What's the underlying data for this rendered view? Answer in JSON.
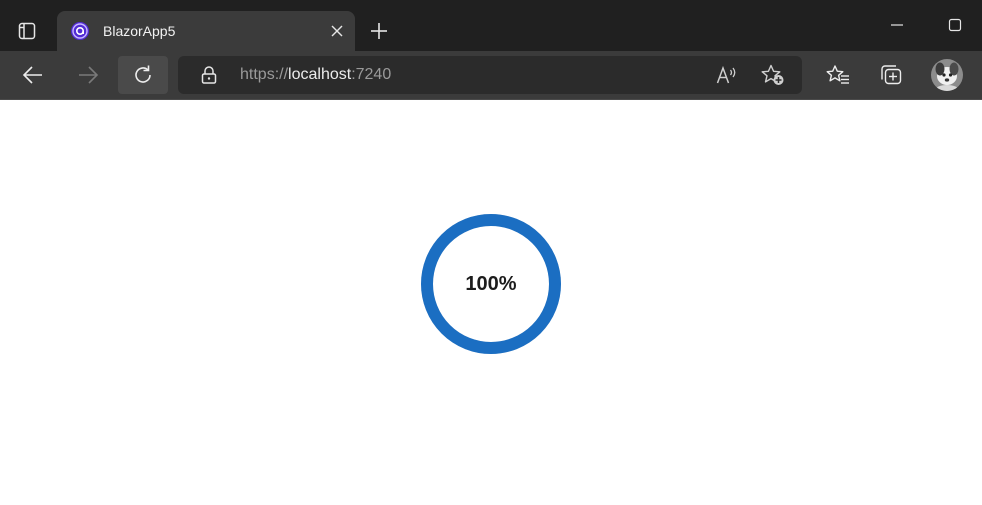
{
  "tab": {
    "title": "BlazorApp5"
  },
  "address": {
    "scheme": "https://",
    "host": "localhost",
    "port": ":7240"
  },
  "page": {
    "progress_percent": 100,
    "progress_label": "100%"
  },
  "icons": {
    "tab_actions": "tab-actions-icon",
    "favicon": "blazor-icon",
    "close": "close-icon",
    "new_tab": "plus-icon",
    "minimize": "minimize-icon",
    "maximize": "maximize-icon",
    "back": "arrow-left-icon",
    "forward": "arrow-right-icon",
    "reload": "refresh-icon",
    "lock": "lock-icon",
    "read_aloud": "read-aloud-icon",
    "add_favorite": "star-add-icon",
    "favorites": "favorites-icon",
    "collections": "collections-icon",
    "profile": "avatar"
  },
  "colors": {
    "titlebar": "#202020",
    "toolbar": "#3b3b3b",
    "progress_ring": "#1b6ec2",
    "favicon_accent": "#7b61ff"
  }
}
